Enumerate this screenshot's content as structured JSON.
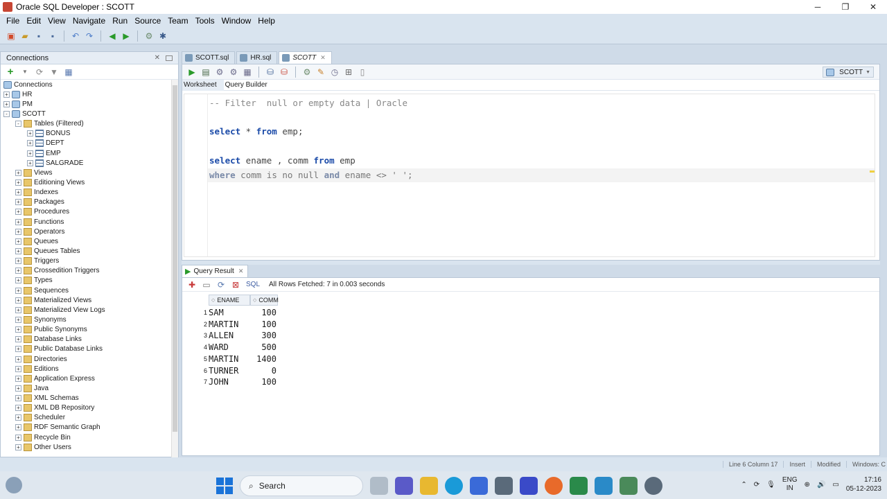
{
  "window": {
    "title": "Oracle SQL Developer : SCOTT"
  },
  "menu": [
    "File",
    "Edit",
    "View",
    "Navigate",
    "Run",
    "Source",
    "Team",
    "Tools",
    "Window",
    "Help"
  ],
  "connections": {
    "title": "Connections",
    "root": "Connections",
    "items": [
      {
        "label": "HR",
        "level": 0,
        "icon": "db",
        "exp": "+"
      },
      {
        "label": "PM",
        "level": 0,
        "icon": "db",
        "exp": "+"
      },
      {
        "label": "SCOTT",
        "level": 0,
        "icon": "db",
        "exp": "-"
      },
      {
        "label": "Tables (Filtered)",
        "level": 1,
        "icon": "folder",
        "exp": "-"
      },
      {
        "label": "BONUS",
        "level": 2,
        "icon": "table",
        "exp": "+"
      },
      {
        "label": "DEPT",
        "level": 2,
        "icon": "table",
        "exp": "+"
      },
      {
        "label": "EMP",
        "level": 2,
        "icon": "table",
        "exp": "+"
      },
      {
        "label": "SALGRADE",
        "level": 2,
        "icon": "table",
        "exp": "+"
      },
      {
        "label": "Views",
        "level": 1,
        "icon": "folder",
        "exp": "+"
      },
      {
        "label": "Editioning Views",
        "level": 1,
        "icon": "folder",
        "exp": "+"
      },
      {
        "label": "Indexes",
        "level": 1,
        "icon": "folder",
        "exp": "+"
      },
      {
        "label": "Packages",
        "level": 1,
        "icon": "folder",
        "exp": "+"
      },
      {
        "label": "Procedures",
        "level": 1,
        "icon": "folder",
        "exp": "+"
      },
      {
        "label": "Functions",
        "level": 1,
        "icon": "folder",
        "exp": "+"
      },
      {
        "label": "Operators",
        "level": 1,
        "icon": "folder",
        "exp": "+"
      },
      {
        "label": "Queues",
        "level": 1,
        "icon": "folder",
        "exp": "+"
      },
      {
        "label": "Queues Tables",
        "level": 1,
        "icon": "folder",
        "exp": "+"
      },
      {
        "label": "Triggers",
        "level": 1,
        "icon": "folder",
        "exp": "+"
      },
      {
        "label": "Crossedition Triggers",
        "level": 1,
        "icon": "folder",
        "exp": "+"
      },
      {
        "label": "Types",
        "level": 1,
        "icon": "folder",
        "exp": "+"
      },
      {
        "label": "Sequences",
        "level": 1,
        "icon": "folder",
        "exp": "+"
      },
      {
        "label": "Materialized Views",
        "level": 1,
        "icon": "folder",
        "exp": "+"
      },
      {
        "label": "Materialized View Logs",
        "level": 1,
        "icon": "folder",
        "exp": "+"
      },
      {
        "label": "Synonyms",
        "level": 1,
        "icon": "folder",
        "exp": "+"
      },
      {
        "label": "Public Synonyms",
        "level": 1,
        "icon": "folder",
        "exp": "+"
      },
      {
        "label": "Database Links",
        "level": 1,
        "icon": "folder",
        "exp": "+"
      },
      {
        "label": "Public Database Links",
        "level": 1,
        "icon": "folder",
        "exp": "+"
      },
      {
        "label": "Directories",
        "level": 1,
        "icon": "folder",
        "exp": "+"
      },
      {
        "label": "Editions",
        "level": 1,
        "icon": "folder",
        "exp": "+"
      },
      {
        "label": "Application Express",
        "level": 1,
        "icon": "folder",
        "exp": "+"
      },
      {
        "label": "Java",
        "level": 1,
        "icon": "folder",
        "exp": "+"
      },
      {
        "label": "XML Schemas",
        "level": 1,
        "icon": "folder",
        "exp": "+"
      },
      {
        "label": "XML DB Repository",
        "level": 1,
        "icon": "folder",
        "exp": "+"
      },
      {
        "label": "Scheduler",
        "level": 1,
        "icon": "folder",
        "exp": "+"
      },
      {
        "label": "RDF Semantic Graph",
        "level": 1,
        "icon": "folder",
        "exp": "+"
      },
      {
        "label": "Recycle Bin",
        "level": 1,
        "icon": "folder",
        "exp": "+"
      },
      {
        "label": "Other Users",
        "level": 1,
        "icon": "folder",
        "exp": "+"
      }
    ]
  },
  "editor": {
    "tabs": [
      {
        "label": "SCOTT.sql",
        "active": false
      },
      {
        "label": "HR.sql",
        "active": false
      },
      {
        "label": "SCOTT",
        "active": true
      }
    ],
    "connection": "SCOTT",
    "subtabs": {
      "worksheet": "Worksheet",
      "query_builder": "Query Builder"
    },
    "lines": {
      "l1": "-- Filter  null or empty data | Oracle",
      "l3_kw1": "select",
      "l3_rest": " * ",
      "l3_kw2": "from",
      "l3_end": " emp;",
      "l5_kw1": "select",
      "l5_rest": " ename , comm ",
      "l5_kw2": "from",
      "l5_end": " emp",
      "l6_kw1": "where",
      "l6_rest": " comm is no null ",
      "l6_kw2": "and",
      "l6_end": " ename <> ' ';"
    }
  },
  "result": {
    "tab_label": "Query Result",
    "sql_label": "SQL",
    "fetch_status": "All Rows Fetched: 7 in 0.003 seconds",
    "columns": [
      "ENAME",
      "COMM"
    ],
    "rows": [
      {
        "n": "1",
        "ename": "SAM",
        "comm": "100"
      },
      {
        "n": "2",
        "ename": "MARTIN",
        "comm": "100"
      },
      {
        "n": "3",
        "ename": "ALLEN",
        "comm": "300"
      },
      {
        "n": "4",
        "ename": "WARD",
        "comm": "500"
      },
      {
        "n": "5",
        "ename": "MARTIN",
        "comm": "1400"
      },
      {
        "n": "6",
        "ename": "TURNER",
        "comm": "0"
      },
      {
        "n": "7",
        "ename": "JOHN",
        "comm": "100"
      }
    ]
  },
  "status": {
    "position": "Line 6 Column 17",
    "mode": "Insert",
    "modified": "Modified",
    "os": "Windows: C"
  },
  "taskbar": {
    "search": "Search",
    "lang": "ENG",
    "region": "IN",
    "time": "17:16",
    "date": "05-12-2023"
  }
}
